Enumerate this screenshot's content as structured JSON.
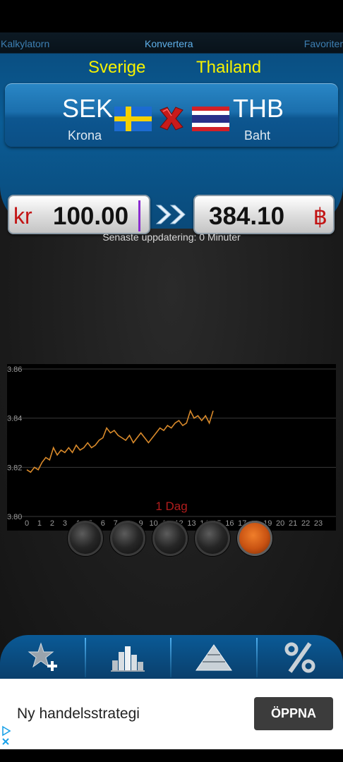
{
  "tabs": {
    "calculator": "Kalkylatorn",
    "convert": "Konvertera",
    "favorites": "Favoriter"
  },
  "from": {
    "country": "Sverige",
    "code": "SEK",
    "name": "Krona",
    "symbol": "kr",
    "amount": "100.00"
  },
  "to": {
    "country": "Thailand",
    "code": "THB",
    "name": "Baht",
    "symbol": "฿",
    "amount": "384.10"
  },
  "last_update": "Senaste uppdatering: 0 Minuter",
  "period_label": "1 Dag",
  "period_buttons": {
    "count": 5,
    "active_index": 4
  },
  "ad": {
    "title": "Ny handelsstrategi",
    "button": "ÖPPNA"
  },
  "colors": {
    "accent_blue": "#0b5c95",
    "country_yellow": "#f6f200",
    "line_orange": "#d98a2b",
    "period_red": "#b21d1d"
  },
  "chart_data": {
    "type": "line",
    "x_ticks": [
      0,
      1,
      2,
      3,
      4,
      5,
      6,
      7,
      8,
      9,
      10,
      11,
      12,
      13,
      14,
      15,
      16,
      17,
      18,
      19,
      20,
      21,
      22,
      23
    ],
    "y_ticks": [
      "3.80",
      "3.82",
      "3.84",
      "3.86"
    ],
    "xlim": [
      0,
      24
    ],
    "ylim": [
      3.8,
      3.86
    ],
    "grid": true,
    "series": [
      {
        "x": [
          0,
          0.3,
          0.6,
          0.9,
          1.2,
          1.5,
          1.8,
          2.1,
          2.4,
          2.7,
          3.0,
          3.3,
          3.6,
          3.9,
          4.2,
          4.5,
          4.8,
          5.1,
          5.4,
          5.7,
          6.0,
          6.3,
          6.6,
          6.9,
          7.2,
          7.5,
          7.8,
          8.1,
          8.4,
          8.7,
          9.0,
          9.3,
          9.6,
          9.9,
          10.2,
          10.5,
          10.8,
          11.1,
          11.4,
          11.7,
          12.0,
          12.3,
          12.6,
          12.9,
          13.2,
          13.5,
          13.8,
          14.1,
          14.4,
          14.7
        ],
        "y": [
          3.819,
          3.818,
          3.82,
          3.819,
          3.822,
          3.824,
          3.823,
          3.828,
          3.825,
          3.827,
          3.826,
          3.828,
          3.826,
          3.829,
          3.827,
          3.828,
          3.83,
          3.828,
          3.829,
          3.831,
          3.832,
          3.836,
          3.834,
          3.835,
          3.833,
          3.832,
          3.831,
          3.833,
          3.83,
          3.832,
          3.834,
          3.832,
          3.83,
          3.832,
          3.834,
          3.836,
          3.835,
          3.837,
          3.836,
          3.838,
          3.839,
          3.837,
          3.838,
          3.843,
          3.84,
          3.841,
          3.839,
          3.841,
          3.838,
          3.843
        ]
      }
    ]
  }
}
